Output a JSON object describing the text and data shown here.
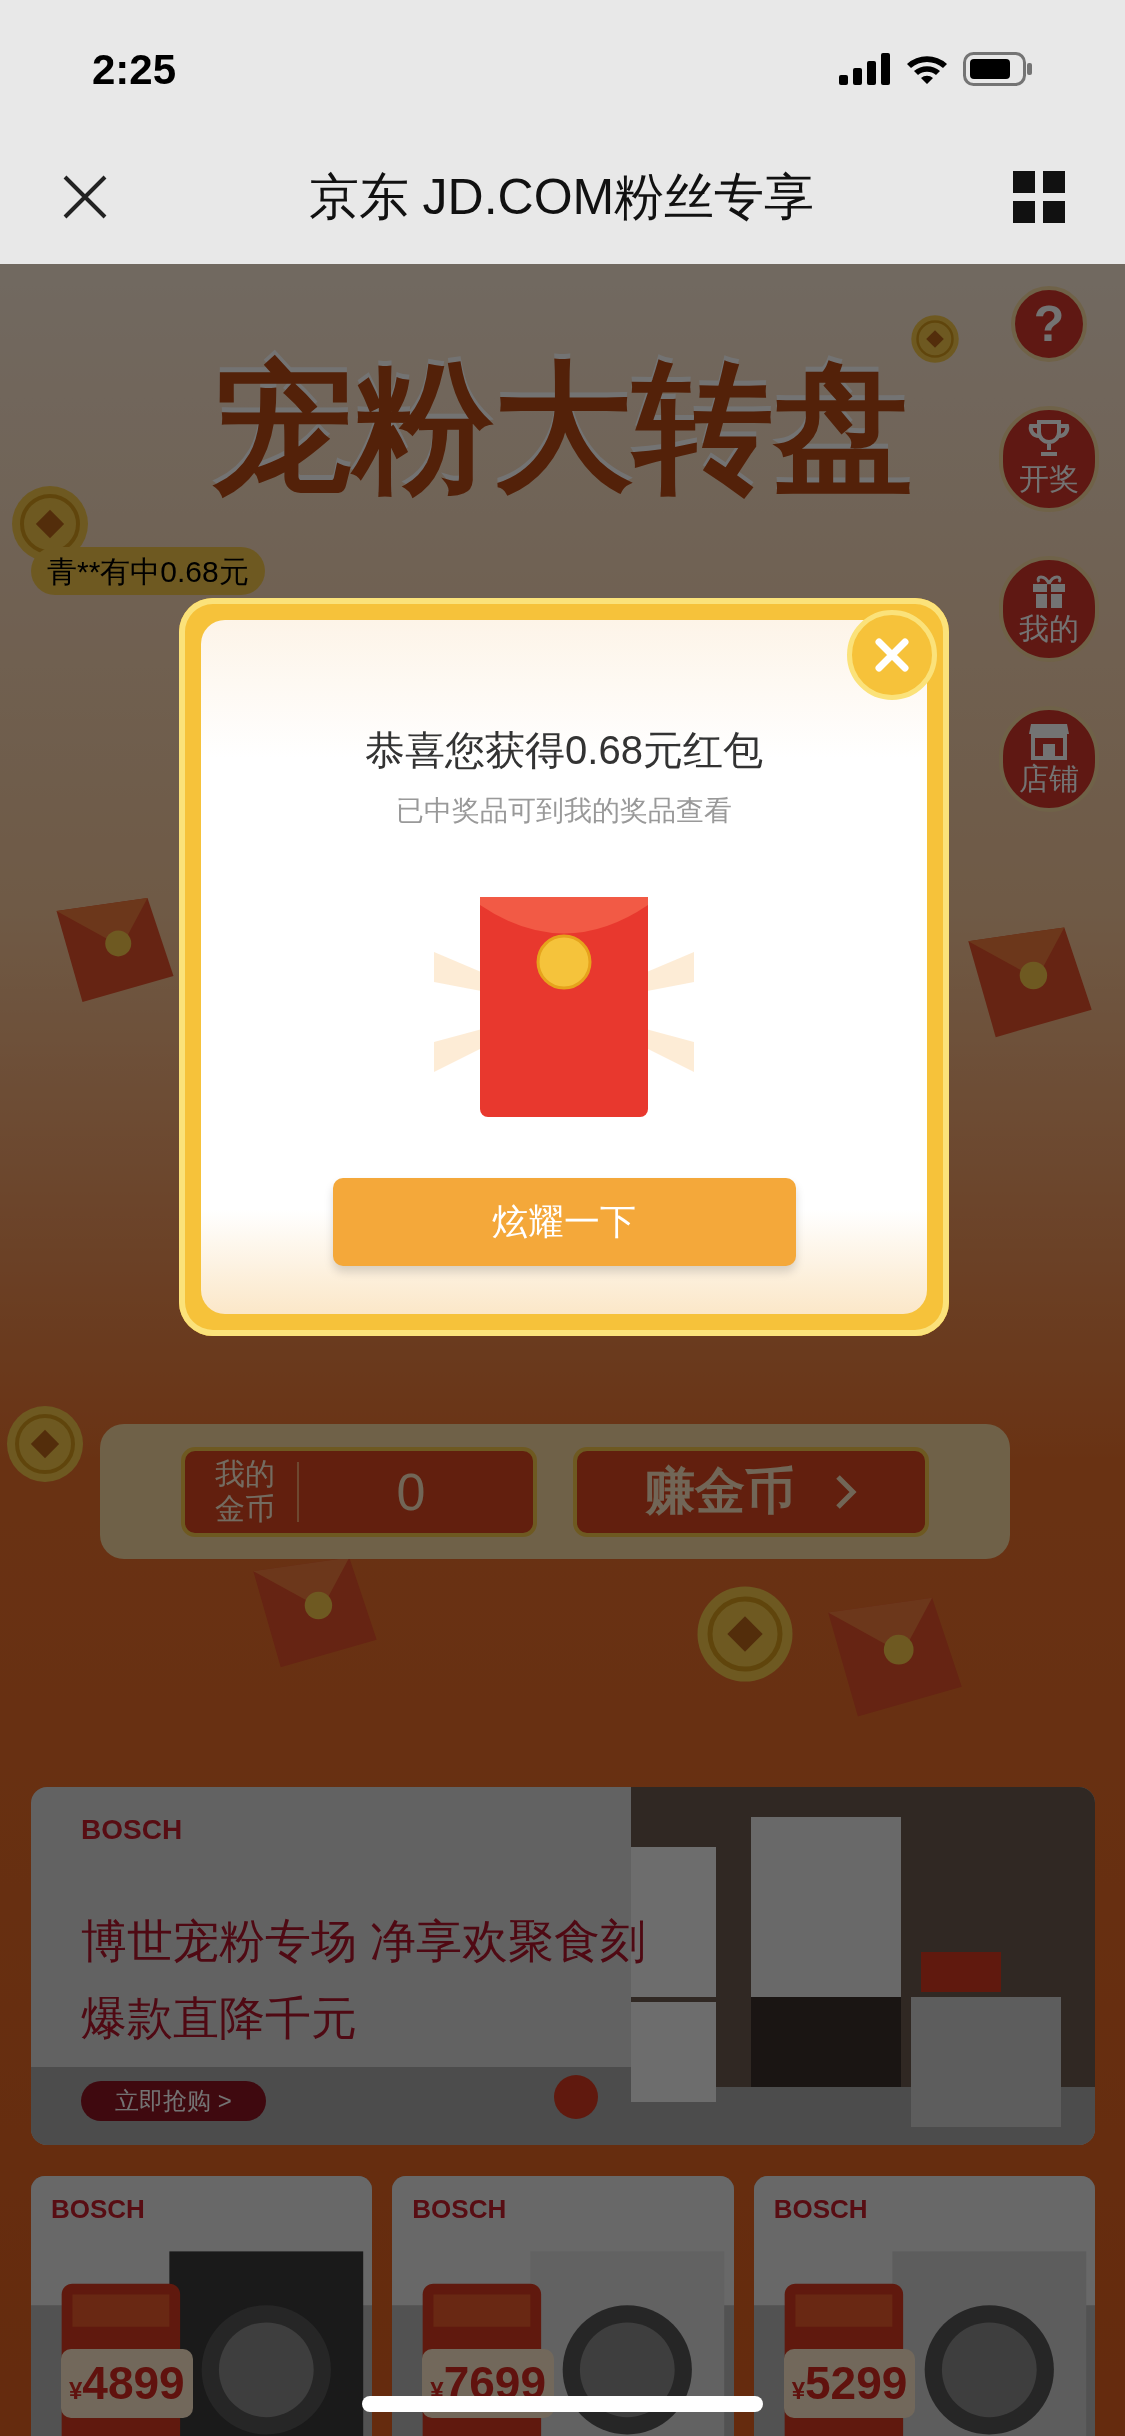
{
  "status_bar": {
    "time": "2:25"
  },
  "nav": {
    "title": "京东 JD.COM粉丝专享"
  },
  "game": {
    "title": "宠粉大转盘",
    "ticker": "青**有中0.68元",
    "side_buttons": [
      {
        "kind": "help",
        "label": "?"
      },
      {
        "kind": "trophy",
        "label": "开奖"
      },
      {
        "kind": "gift",
        "label": "我的"
      },
      {
        "kind": "shop",
        "label": "店铺"
      }
    ],
    "coins": {
      "label": "我的金币",
      "value": "0"
    },
    "earn_button": {
      "label": "赚金币"
    }
  },
  "popup": {
    "title": "恭喜您获得0.68元红包",
    "subtitle": "已中奖品可到我的奖品查看",
    "button": "炫耀一下"
  },
  "banner": {
    "brand": "BOSCH",
    "headline": "博世宠粉专场 净享欢聚食刻",
    "subline": "爆款直降千元",
    "cta": "立即抢购 >"
  },
  "products": [
    {
      "brand": "BOSCH",
      "currency": "¥",
      "price": "4899"
    },
    {
      "brand": "BOSCH",
      "currency": "¥",
      "price": "7699"
    },
    {
      "brand": "BOSCH",
      "currency": "¥",
      "price": "5299"
    }
  ]
}
